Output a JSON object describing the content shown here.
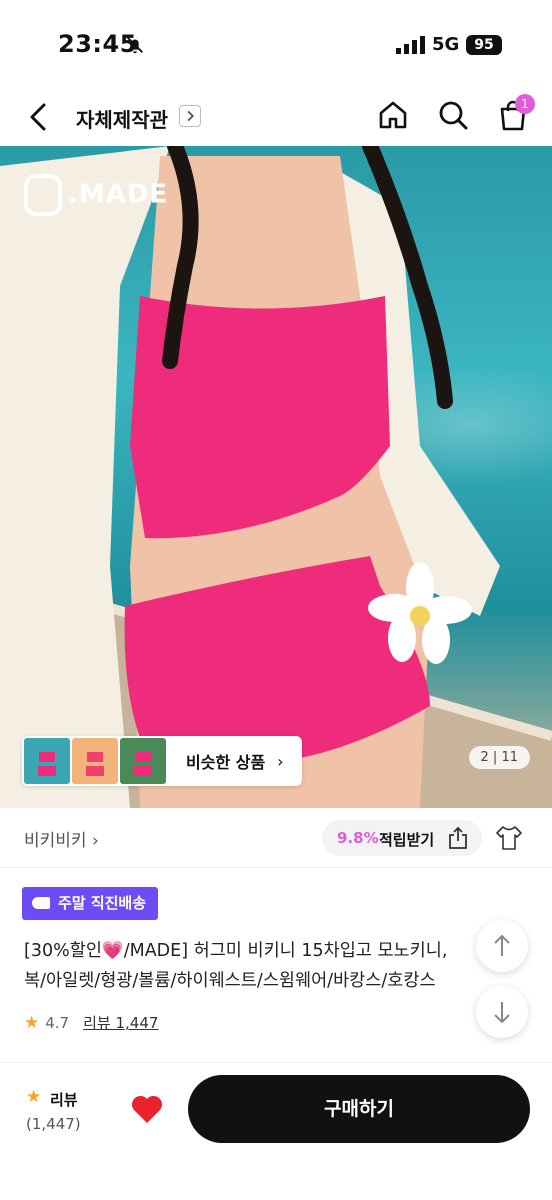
{
  "status_bar": {
    "time": "23:45",
    "network": "5G",
    "battery": "95"
  },
  "header": {
    "title": "자체제작관",
    "cart_count": "1"
  },
  "hero": {
    "logo_text": ".MADE",
    "page_indicator": "2 | 11",
    "similar_label": "비슷한 상품"
  },
  "store": {
    "name": "비키비키",
    "rate": "9.8%",
    "save_label": "적립받기"
  },
  "product": {
    "badge": "주말 직진배송",
    "name_line1": "[30%할인💗/MADE] 허그미 비키니 15차입고 모노키니,",
    "name_line2": "복/아일렛/형광/볼륨/하이웨스트/스윔웨어/바캉스/호캉스",
    "rating": "4.7",
    "reviews_link": "리뷰 1,447"
  },
  "bottom_bar": {
    "review_label": "리뷰",
    "review_count": "(1,447)",
    "buy_label": "구매하기"
  },
  "colors": {
    "accent": "#e45bd7",
    "badge": "#6d4cf5",
    "buy_button": "#111111",
    "heart": "#e8232d"
  }
}
